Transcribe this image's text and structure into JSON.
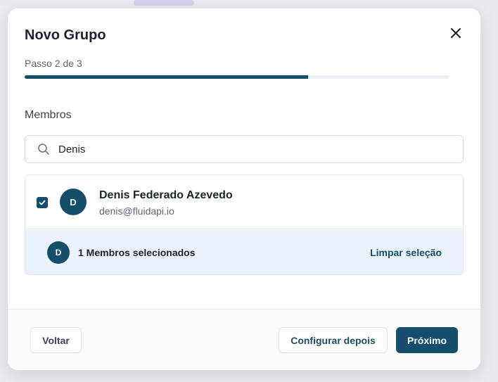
{
  "modal": {
    "title": "Novo Grupo",
    "step_text": "Passo 2 de 3",
    "progress_fraction": 0.667,
    "section_label": "Membros"
  },
  "search": {
    "value": "Denis"
  },
  "members": [
    {
      "initial": "D",
      "name": "Denis Federado Azevedo",
      "email": "denis@fluidapi.io",
      "checked": true
    }
  ],
  "selection": {
    "avatar_initial": "D",
    "count_text": "1 Membros selecionados",
    "clear_label": "Limpar seleção"
  },
  "footer": {
    "back_label": "Voltar",
    "later_label": "Configurar depois",
    "next_label": "Próximo"
  },
  "colors": {
    "accent": "#154e6b",
    "selection_bg": "#eaf3fb"
  },
  "icons": {
    "close": "close-icon",
    "search": "search-icon",
    "check": "check-icon"
  }
}
